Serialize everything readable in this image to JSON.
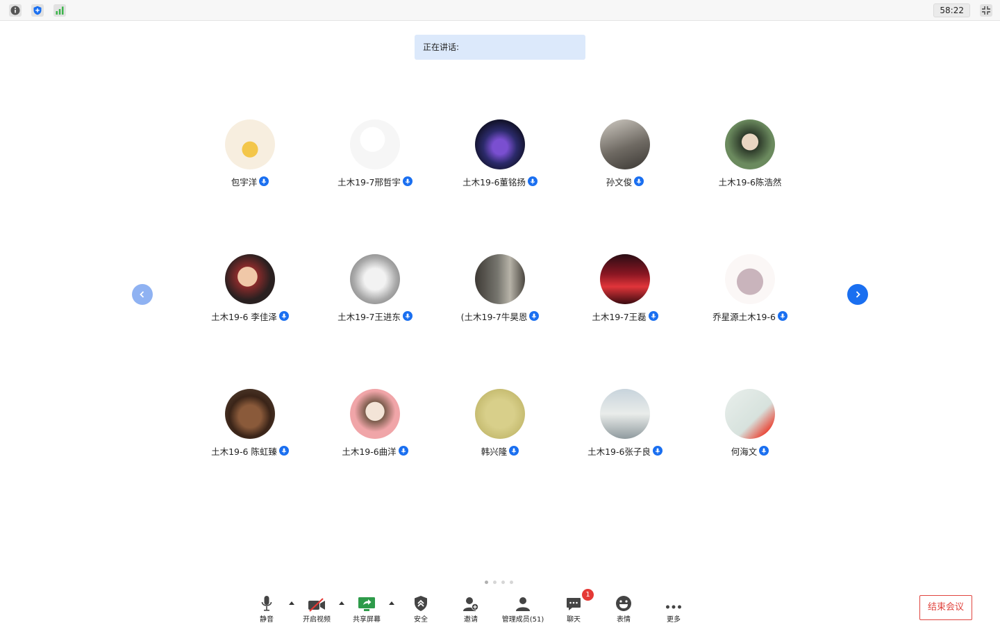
{
  "timer": "58:22",
  "speaking_label": "正在讲话:",
  "participants": [
    {
      "name": "包宇洋"
    },
    {
      "name": "土木19-7邢哲宇"
    },
    {
      "name": "土木19-6董铭扬"
    },
    {
      "name": "孙文俊"
    },
    {
      "name": "土木19-6陈浩然"
    },
    {
      "name": "土木19-6 李佳泽"
    },
    {
      "name": "土木19-7王进东"
    },
    {
      "name": "(土木19-7牛昊恩"
    },
    {
      "name": "土木19-7王磊"
    },
    {
      "name": "乔星源土木19-6"
    },
    {
      "name": "土木19-6 陈虹臻"
    },
    {
      "name": "土木19-6曲洋"
    },
    {
      "name": "韩兴隆"
    },
    {
      "name": "土木19-6张子良"
    },
    {
      "name": "何海文"
    }
  ],
  "toolbar": {
    "mute": "静音",
    "video": "开启视频",
    "share": "共享屏幕",
    "security": "安全",
    "invite": "邀请",
    "members": "管理成员(51)",
    "chat": "聊天",
    "chat_badge": "1",
    "reactions": "表情",
    "more": "更多"
  },
  "end_button": "结束会议",
  "colors": {
    "accent": "#1a6ff0",
    "end_red": "#e0443e",
    "speaking_bg": "#dce9fb"
  }
}
